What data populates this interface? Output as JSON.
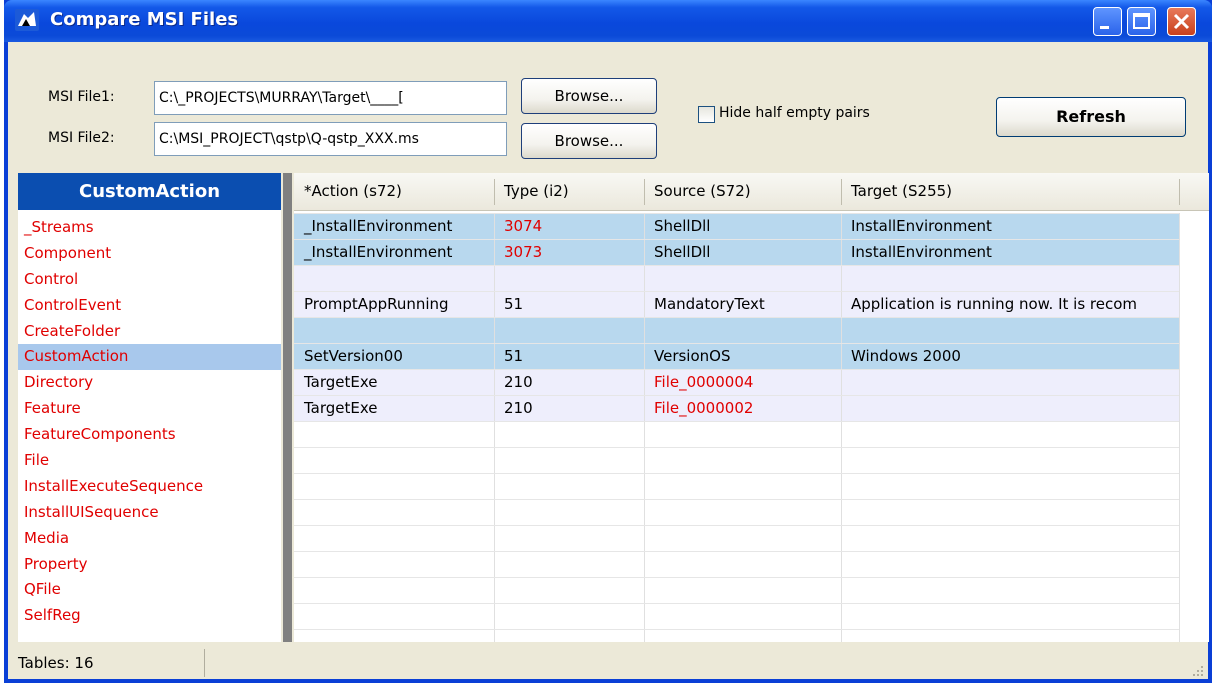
{
  "window": {
    "title": "Compare MSI Files"
  },
  "files": {
    "file1_label": "MSI File1:",
    "file1_value": "C:\\_PROJECTS\\MURRAY\\Target\\____[",
    "file2_label": "MSI File2:",
    "file2_value": "C:\\MSI_PROJECT\\qstp\\Q-qstp_XXX.ms",
    "browse1_label": "Browse...",
    "browse2_label": "Browse...",
    "hide_label": "Hide half empty pairs",
    "hide_checked": false,
    "refresh_label": "Refresh"
  },
  "tables": {
    "header": "CustomAction",
    "selected": "CustomAction",
    "items": [
      "_Streams",
      "Component",
      "Control",
      "ControlEvent",
      "CreateFolder",
      "CustomAction",
      "Directory",
      "Feature",
      "FeatureComponents",
      "File",
      "InstallExecuteSequence",
      "InstallUISequence",
      "Media",
      "Property",
      "QFile",
      "SelfReg"
    ]
  },
  "grid": {
    "columns": [
      "*Action (s72)",
      "Type (i2)",
      "Source (S72)",
      "Target (S255)"
    ],
    "rows": [
      {
        "cells": [
          "_InstallEnvironment",
          "3074",
          "ShellDll",
          "InstallEnvironment"
        ],
        "style": "blue",
        "red": [
          1
        ]
      },
      {
        "cells": [
          "_InstallEnvironment",
          "3073",
          "ShellDll",
          "InstallEnvironment"
        ],
        "style": "blue",
        "red": [
          1
        ]
      },
      {
        "cells": [
          "",
          "",
          "",
          ""
        ],
        "style": "lav",
        "red": []
      },
      {
        "cells": [
          "PromptAppRunning",
          "51",
          "MandatoryText",
          "Application is running now. It is recom"
        ],
        "style": "lav",
        "red": []
      },
      {
        "cells": [
          "",
          "",
          "",
          ""
        ],
        "style": "blue",
        "red": []
      },
      {
        "cells": [
          "SetVersion00",
          "51",
          "VersionOS",
          "Windows 2000"
        ],
        "style": "blue",
        "red": []
      },
      {
        "cells": [
          "TargetExe",
          "210",
          "File_0000004",
          ""
        ],
        "style": "lav",
        "red": [
          2
        ]
      },
      {
        "cells": [
          "TargetExe",
          "210",
          "File_0000002",
          ""
        ],
        "style": "lav",
        "red": [
          2
        ]
      }
    ]
  },
  "status": {
    "text": "Tables: 16"
  },
  "colors": {
    "title_bar": "#0a48dc",
    "diff_red": "#e00000",
    "row_blue": "#b8d8ee",
    "row_lavender": "#eeeefc",
    "selected_item": "#a8c8ec"
  }
}
